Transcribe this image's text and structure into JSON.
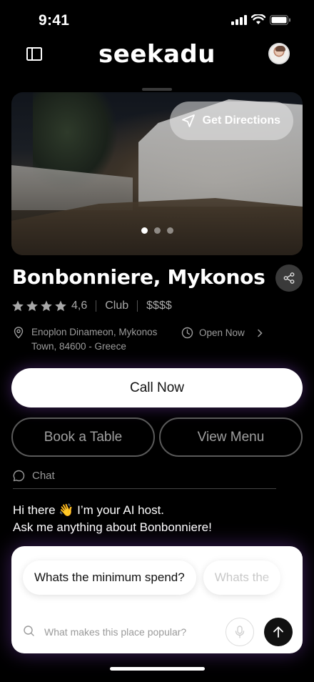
{
  "status_bar": {
    "time": "9:41"
  },
  "header": {
    "logo": "seekadu"
  },
  "hero": {
    "directions_label": "Get Directions",
    "image_count": 3,
    "active_image": 1
  },
  "venue": {
    "name": "Bonbonniere, Mykonos",
    "rating": "4,6",
    "rating_value": 4.6,
    "category": "Club",
    "price": "$$$$",
    "address_line1": "Enoplon Dinameon, Mykonos",
    "address_line2": "Town, 84600 - Greece",
    "hours": "Open Now"
  },
  "actions": {
    "call": "Call Now",
    "book": "Book a Table",
    "menu": "View Menu"
  },
  "chat": {
    "label": "Chat",
    "greeting_line1": "Hi there 👋 I’m your AI host.",
    "greeting_line2": "Ask me anything about Bonbonniere!",
    "suggestions": [
      "Whats the minimum spend?",
      "Whats the"
    ],
    "input_placeholder": "What makes this place popular?"
  },
  "colors": {
    "background": "#000000",
    "accent_glow": "#aa5aff",
    "primary_button": "#ffffff"
  },
  "icons": [
    "sidebar-icon",
    "avatar",
    "navigation-arrow-icon",
    "share-icon",
    "star-icon",
    "location-pin-icon",
    "clock-icon",
    "chevron-right-icon",
    "chat-bubble-icon",
    "search-icon",
    "microphone-icon",
    "arrow-up-icon"
  ]
}
